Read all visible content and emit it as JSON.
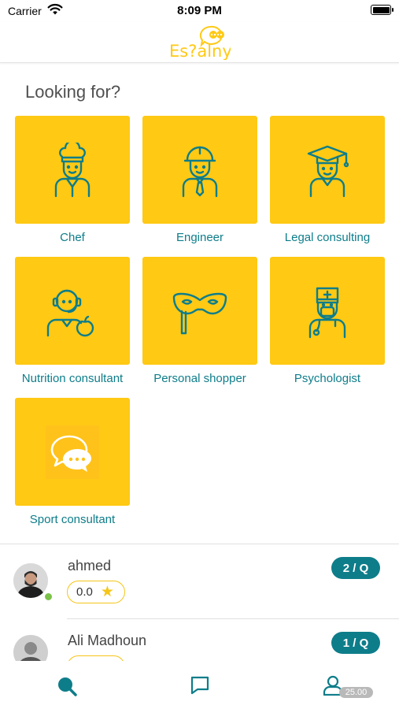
{
  "status_bar": {
    "carrier": "Carrier",
    "time": "8:09 PM"
  },
  "header": {
    "logo_text": "Es?alny"
  },
  "section": {
    "title": "Looking for?"
  },
  "categories": [
    {
      "label": "Chef",
      "icon": "chef-icon"
    },
    {
      "label": "Engineer",
      "icon": "engineer-icon"
    },
    {
      "label": "Legal consulting",
      "icon": "graduate-icon"
    },
    {
      "label": "Nutrition consultant",
      "icon": "nutrition-icon"
    },
    {
      "label": "Personal shopper",
      "icon": "mask-icon"
    },
    {
      "label": "Psychologist",
      "icon": "doctor-icon"
    },
    {
      "label": "Sport consultant",
      "icon": "chat-bubbles-icon"
    }
  ],
  "consultants": [
    {
      "name": "ahmed",
      "rating": "0.0",
      "price": "2 / Q",
      "online": true
    },
    {
      "name": "Ali Madhoun",
      "rating": "",
      "price": "1 / Q",
      "online": false
    }
  ],
  "tabbar": {
    "balance": "25.00"
  },
  "colors": {
    "accent_yellow": "#ffc914",
    "teal": "#0e7d8a",
    "online_green": "#7bc24a"
  }
}
